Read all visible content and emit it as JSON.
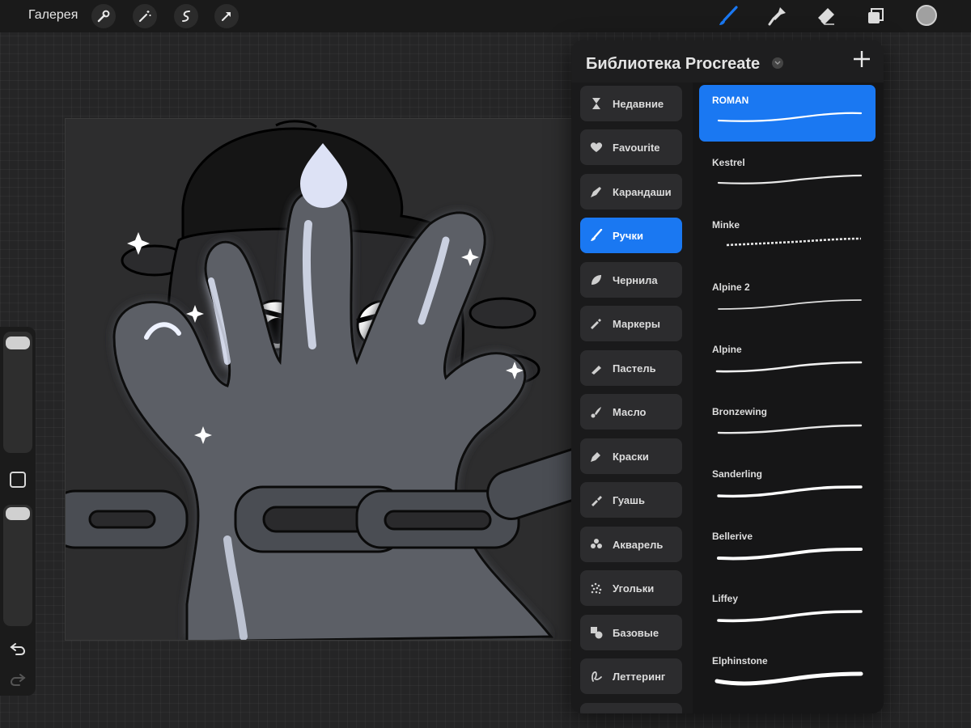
{
  "topbar": {
    "gallery_label": "Галерея",
    "left_tools": [
      "wrench-icon",
      "magic-wand-icon",
      "selection-icon",
      "transform-arrow-icon"
    ],
    "right_tools": [
      "brush-icon",
      "smudge-icon",
      "eraser-icon",
      "layers-icon"
    ],
    "current_color": "#a0a0a0",
    "accent_color": "#1a78f2"
  },
  "sidebar": {
    "brush_size_level": 0.02,
    "opacity_level": 0.02,
    "undo_icon": "undo-icon",
    "redo_icon": "redo-icon"
  },
  "brush_library": {
    "title": "Библиотека Procreate",
    "add_icon": "plus-icon",
    "categories": [
      {
        "label": "Недавние",
        "icon": "hourglass-icon"
      },
      {
        "label": "Favourite",
        "icon": "heart-icon"
      },
      {
        "label": "Карандаши",
        "icon": "pencil-icon"
      },
      {
        "label": "Ручки",
        "icon": "pen-icon",
        "active": true
      },
      {
        "label": "Чернила",
        "icon": "ink-drop-icon"
      },
      {
        "label": "Маркеры",
        "icon": "marker-icon"
      },
      {
        "label": "Пастель",
        "icon": "pastel-icon"
      },
      {
        "label": "Масло",
        "icon": "oil-brush-icon"
      },
      {
        "label": "Краски",
        "icon": "paint-icon"
      },
      {
        "label": "Гуашь",
        "icon": "gouache-icon"
      },
      {
        "label": "Акварель",
        "icon": "watercolor-icon"
      },
      {
        "label": "Угольки",
        "icon": "charcoal-icon"
      },
      {
        "label": "Базовые",
        "icon": "shapes-icon"
      },
      {
        "label": "Леттеринг",
        "icon": "lettering-icon"
      }
    ],
    "brushes": [
      {
        "name": "ROMAN",
        "active": true
      },
      {
        "name": "Kestrel"
      },
      {
        "name": "Minke"
      },
      {
        "name": "Alpine 2"
      },
      {
        "name": "Alpine"
      },
      {
        "name": "Bronzewing"
      },
      {
        "name": "Sanderling"
      },
      {
        "name": "Bellerive"
      },
      {
        "name": "Liffey"
      },
      {
        "name": "Elphinstone"
      }
    ]
  }
}
